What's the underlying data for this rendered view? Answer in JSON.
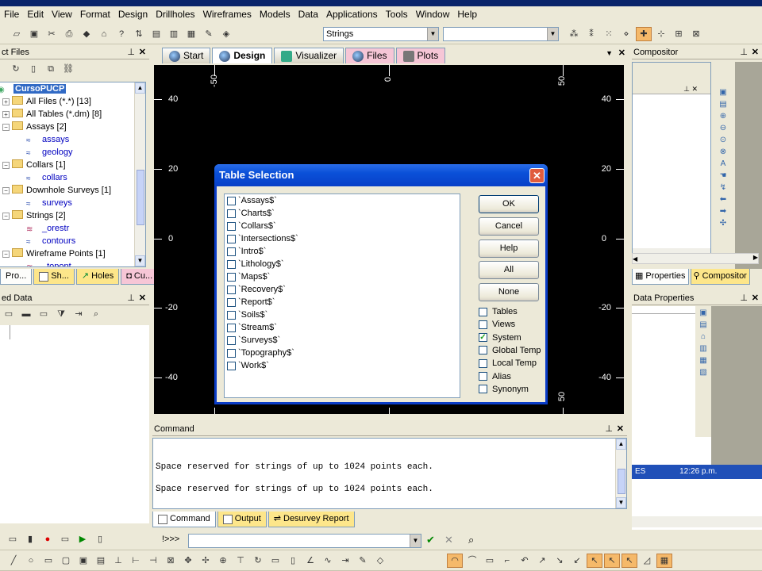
{
  "menu": [
    "File",
    "Edit",
    "View",
    "Format",
    "Design",
    "Drillholes",
    "Wireframes",
    "Models",
    "Data",
    "Applications",
    "Tools",
    "Window",
    "Help"
  ],
  "toolbar": {
    "strings_combo": "Strings",
    "second_combo": ""
  },
  "project_files": {
    "title": "ct Files",
    "root": "CursoPUCP",
    "items": [
      {
        "label": "All Files (*.*) [13]",
        "type": "folder",
        "level": 1
      },
      {
        "label": "All Tables (*.dm) [8]",
        "type": "folder",
        "level": 1
      },
      {
        "label": "Assays [2]",
        "type": "folder",
        "level": 1
      },
      {
        "label": "assays",
        "type": "leaf",
        "level": 2
      },
      {
        "label": "geology",
        "type": "leaf",
        "level": 2
      },
      {
        "label": "Collars [1]",
        "type": "folder",
        "level": 1
      },
      {
        "label": "collars",
        "type": "leaf",
        "level": 2
      },
      {
        "label": "Downhole Surveys [1]",
        "type": "folder",
        "level": 1
      },
      {
        "label": "surveys",
        "type": "leaf",
        "level": 2
      },
      {
        "label": "Strings [2]",
        "type": "folder",
        "level": 1
      },
      {
        "label": "_orestr",
        "type": "leaf",
        "level": 2
      },
      {
        "label": "contours",
        "type": "leaf",
        "level": 2
      },
      {
        "label": "Wireframe Points [1]",
        "type": "folder",
        "level": 1
      },
      {
        "label": "_topopt",
        "type": "leaf",
        "level": 2
      }
    ],
    "bottom_tabs": [
      "Pro...",
      "Sh...",
      "Holes",
      "Cu..."
    ]
  },
  "loaded_data": {
    "title": "ed Data"
  },
  "main_tabs": [
    "Start",
    "Design",
    "Visualizer",
    "Files",
    "Plots"
  ],
  "main_tab_selected": "Design",
  "viewport": {
    "y_labels": [
      "40",
      "20",
      "0",
      "-20",
      "-40"
    ],
    "x_top_labels": [
      "-50",
      "0",
      "50"
    ],
    "x_bottom_labels": [
      "50"
    ]
  },
  "dialog": {
    "title": "Table Selection",
    "tables": [
      "`Assays$`",
      "`Charts$`",
      "`Collars$`",
      "`Intersections$`",
      "`Intro$`",
      "`Lithology$`",
      "`Maps$`",
      "`Recovery$`",
      "`Report$`",
      "`Soils$`",
      "`Stream$`",
      "`Surveys$`",
      "`Topography$`",
      "`Work$`"
    ],
    "buttons": {
      "ok": "OK",
      "cancel": "Cancel",
      "help": "Help",
      "all": "All",
      "none": "None"
    },
    "options": [
      {
        "label": "Tables",
        "checked": false
      },
      {
        "label": "Views",
        "checked": false
      },
      {
        "label": "System",
        "checked": true
      },
      {
        "label": "Global Temp",
        "checked": false
      },
      {
        "label": "Local Temp",
        "checked": false
      },
      {
        "label": "Alias",
        "checked": false
      },
      {
        "label": "Synonym",
        "checked": false
      }
    ]
  },
  "command": {
    "title": "Command",
    "lines": [
      "Space reserved for strings of up to 1024 points each.",
      "Space reserved for strings of up to 1024 points each."
    ],
    "tabs": [
      "Command",
      "Output",
      "Desurvey Report"
    ],
    "prompt": "!>>>"
  },
  "compositor": {
    "title": "Compositor",
    "tabs": [
      "Properties",
      "Compositor"
    ]
  },
  "data_properties": {
    "title": "Data Properties"
  },
  "taskbar": {
    "lang": "ES",
    "time": "12:26 p.m."
  }
}
